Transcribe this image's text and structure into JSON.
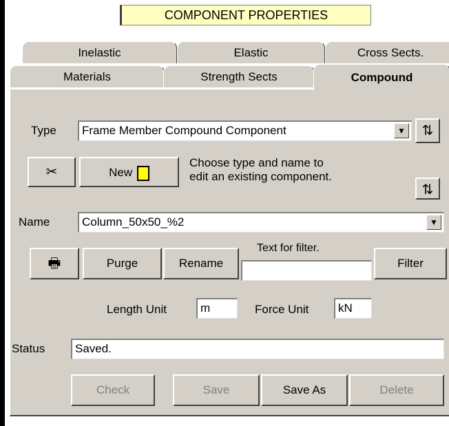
{
  "title": "COMPONENT PROPERTIES",
  "tabs_back": [
    "Inelastic",
    "Elastic",
    "Cross Sects."
  ],
  "tabs_front": [
    "Materials",
    "Strength Sects",
    "Compound"
  ],
  "type": {
    "label": "Type",
    "value": "Frame Member Compound Component"
  },
  "new_button": {
    "label": "New"
  },
  "hint": {
    "line1": "Choose type and name to",
    "line2": "edit an existing component."
  },
  "name": {
    "label": "Name",
    "value": "Column_50x50_%2"
  },
  "buttons": {
    "purge": "Purge",
    "rename": "Rename",
    "filter": "Filter"
  },
  "filter_text": {
    "label": "Text for filter.",
    "value": ""
  },
  "units": {
    "length_label": "Length Unit",
    "length_value": "m",
    "force_label": "Force Unit",
    "force_value": "kN"
  },
  "status": {
    "label": "Status",
    "value": "Saved."
  },
  "bottom_buttons": {
    "check": "Check",
    "save": "Save",
    "save_as": "Save As",
    "delete": "Delete"
  },
  "icons": {
    "refresh": "refresh-icon",
    "tool": "scissors-icon",
    "print": "printer-icon",
    "new_doc": "new-document-icon"
  },
  "colors": {
    "title_bg": "#ffffc0",
    "panel_bg": "#d4d0c8",
    "new_doc_icon": "#ffff00"
  }
}
